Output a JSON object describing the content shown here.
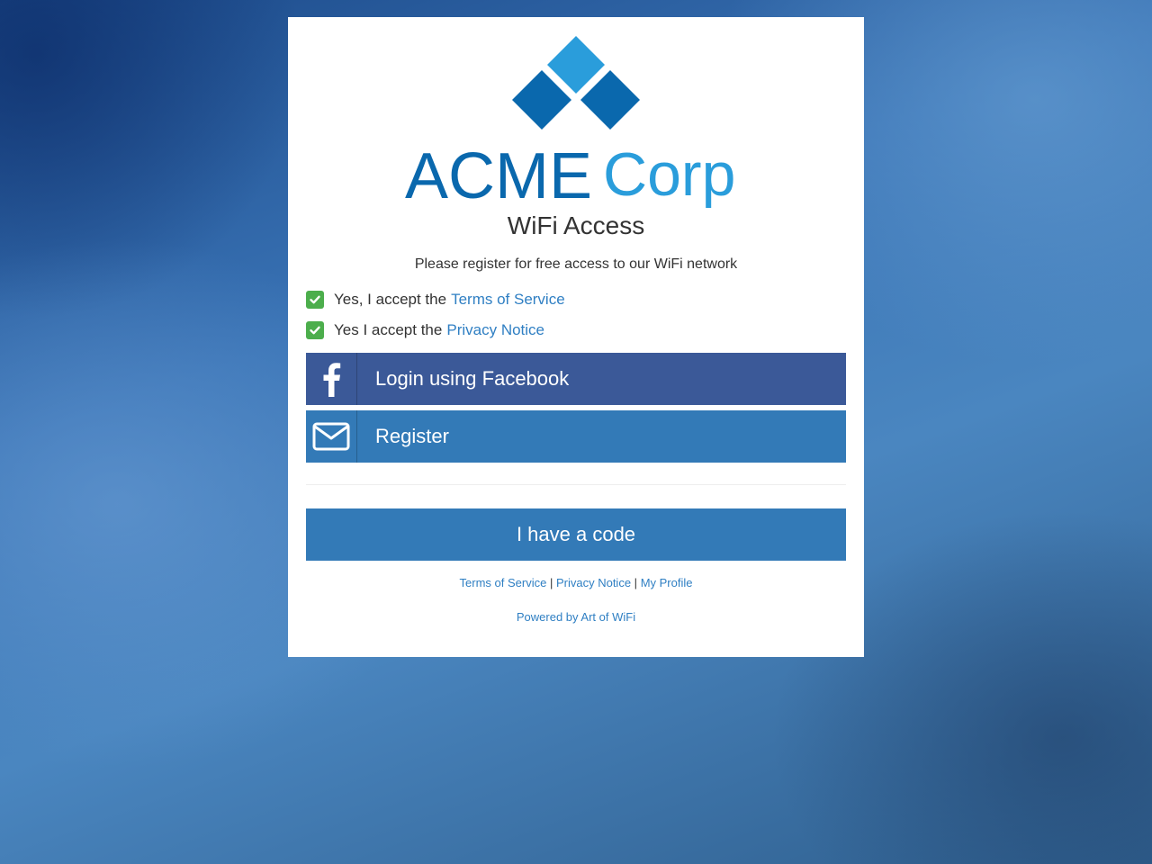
{
  "brand": {
    "name_part1": "ACME",
    "name_part2": "Corp",
    "color_dark": "#0a68ad",
    "color_light": "#2a9ddb"
  },
  "page": {
    "title": "WiFi Access",
    "subtitle": "Please register for free access to our WiFi network"
  },
  "consents": [
    {
      "checked": true,
      "prefix": "Yes, I accept the",
      "link": "Terms of Service",
      "icon": "checkmark-icon"
    },
    {
      "checked": true,
      "prefix": "Yes I accept the",
      "link": "Privacy Notice",
      "icon": "checkmark-icon"
    }
  ],
  "buttons": {
    "facebook": {
      "label": "Login using Facebook",
      "icon": "facebook-icon",
      "color": "#3b5998"
    },
    "register": {
      "label": "Register",
      "icon": "envelope-icon",
      "color": "#337ab7"
    },
    "code": {
      "label": "I have a code",
      "color": "#337ab7"
    }
  },
  "footer": {
    "links": [
      "Terms of Service",
      "Privacy Notice",
      "My Profile"
    ],
    "separator": "|",
    "powered_by": "Powered by Art of WiFi"
  },
  "colors": {
    "checkbox": "#4cae4c",
    "link": "#2f7fc3"
  }
}
